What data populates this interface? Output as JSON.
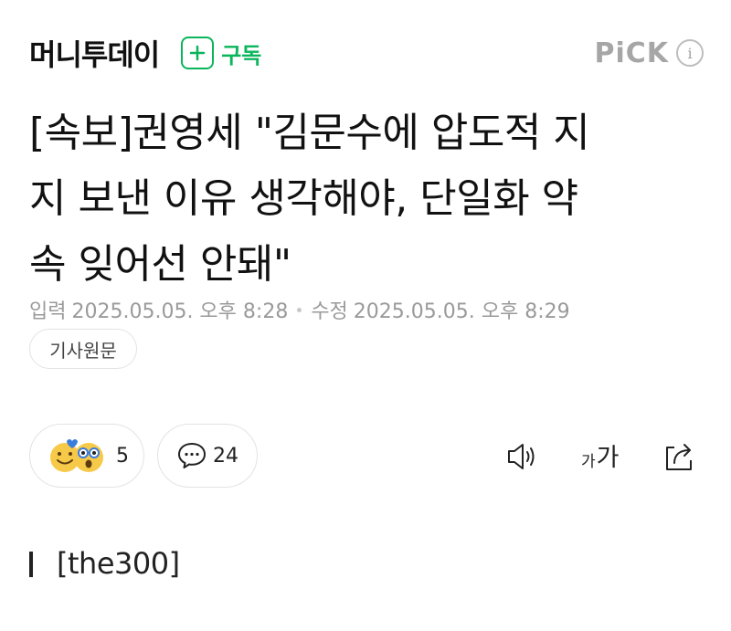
{
  "header": {
    "press_name": "머니투데이",
    "subscribe_label": "구독",
    "pick_label": "PiCK",
    "info_label": "i"
  },
  "article": {
    "headline_lines": [
      "[속보]권영세 \"김문수에 압도적 지",
      "지 보낸 이유 생각해야, 단일화 약",
      "속 잊어선 안돼\""
    ],
    "input_label": "입력",
    "input_time": "2025.05.05. 오후 8:28",
    "modified_label": "수정",
    "modified_time": "2025.05.05. 오후 8:29",
    "original_button": "기사원문"
  },
  "actions": {
    "reaction_count": "5",
    "comment_count": "24",
    "font_small": "가",
    "font_large": "가"
  },
  "section": {
    "label": "[the300]"
  },
  "colors": {
    "accent_green": "#0bb55c",
    "muted_gray": "#9a9a9a",
    "pick_gray": "#a6a6a6"
  },
  "icons": [
    "plus-icon",
    "info-icon",
    "smile-emoji-icon",
    "surprised-emoji-icon",
    "comment-icon",
    "speaker-icon",
    "share-icon"
  ]
}
